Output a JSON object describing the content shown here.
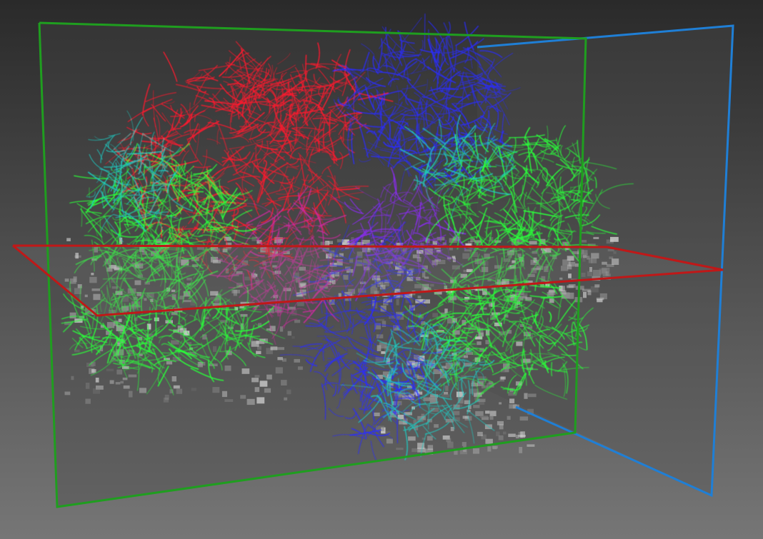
{
  "scene": {
    "background": {
      "top": "#2a2a2a",
      "bottom": "#767676"
    },
    "planes": {
      "sagittal": {
        "color": "#1f9e1f",
        "fill": "rgba(70,70,70,0.35)"
      },
      "coronal": {
        "color": "#1f7fd6",
        "fill": "rgba(80,80,80,0.35)"
      },
      "axial": {
        "color": "#c01818",
        "fill": "rgba(120,120,120,0.25)"
      }
    },
    "fiber_colors": {
      "left_right": "#ff1a2e",
      "superior_inferior": "#2a2cff",
      "anterior_posterior": "#2aff3a",
      "mixed_cyan": "#20c8c0",
      "mixed_magenta": "#d02aa0",
      "mixed_violet": "#8a2cf0"
    },
    "anatomy_slice": {
      "color": "#cfcfcf"
    }
  }
}
